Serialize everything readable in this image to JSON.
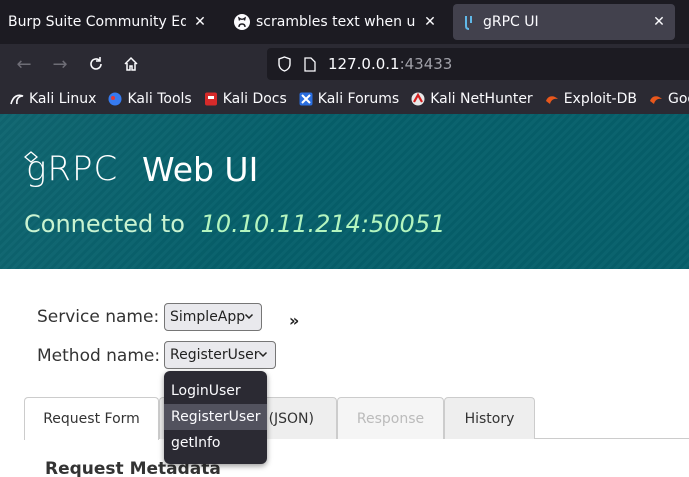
{
  "browser": {
    "tabs": [
      {
        "title": "Burp Suite Community Edition",
        "active": false
      },
      {
        "title": "scrambles text when using",
        "active": false
      },
      {
        "title": "gRPC UI",
        "active": true
      }
    ],
    "url": {
      "host": "127.0.0.1",
      "port": ":43433"
    },
    "bookmarks": [
      {
        "label": "Kali Linux",
        "icon": "kali-dragon-icon"
      },
      {
        "label": "Kali Tools",
        "icon": "kali-tools-icon"
      },
      {
        "label": "Kali Docs",
        "icon": "kali-docs-icon"
      },
      {
        "label": "Kali Forums",
        "icon": "kali-forums-icon"
      },
      {
        "label": "Kali NetHunter",
        "icon": "kali-nethunter-icon"
      },
      {
        "label": "Exploit-DB",
        "icon": "exploit-db-icon"
      },
      {
        "label": "Goog",
        "icon": "ghdb-icon"
      }
    ]
  },
  "header": {
    "logo_text": "gRPC",
    "app_title": "Web UI",
    "connected_label": "Connected to",
    "address": "10.10.11.214:50051"
  },
  "form": {
    "service_label": "Service name:",
    "service_value": "SimpleApp",
    "method_label": "Method name:",
    "method_value": "RegisterUser",
    "expand_symbol": "»",
    "method_options": [
      "LoginUser",
      "RegisterUser",
      "getInfo"
    ],
    "method_selected_index": 1
  },
  "panel_tabs": [
    {
      "label": "Request Form",
      "state": "active"
    },
    {
      "label": "(JSON)",
      "state": "normal"
    },
    {
      "label": "Response",
      "state": "disabled"
    },
    {
      "label": "History",
      "state": "normal"
    }
  ],
  "section": {
    "title": "Request Metadata"
  },
  "colors": {
    "header_bg": "#06606b",
    "connected_text": "#c9f3d1",
    "browser_dark": "#1c1b22"
  }
}
